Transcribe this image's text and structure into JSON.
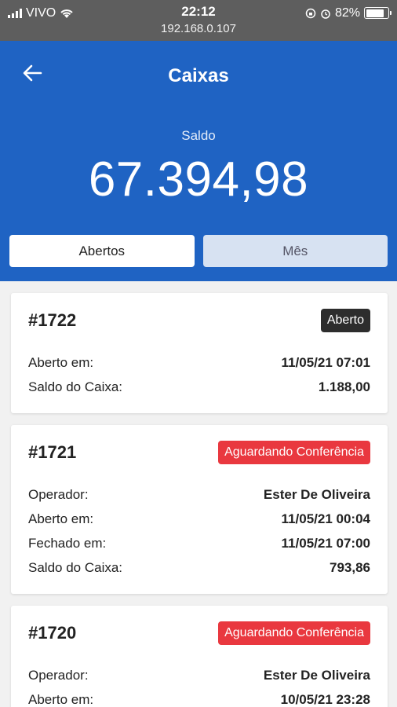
{
  "status": {
    "carrier": "VIVO",
    "time": "22:12",
    "battery": "82%",
    "url": "192.168.0.107",
    "battery_level": 0.82
  },
  "header": {
    "title": "Caixas",
    "saldo_label": "Saldo",
    "saldo_value": "67.394,98"
  },
  "tabs": [
    {
      "label": "Abertos",
      "active": true
    },
    {
      "label": "Mês",
      "active": false
    }
  ],
  "cards": [
    {
      "id": "#1722",
      "badge": "Aberto",
      "badge_color": "#2d2d2d",
      "rows": [
        {
          "k": "Aberto em:",
          "v": "11/05/21 07:01"
        },
        {
          "k": "Saldo do Caixa:",
          "v": "1.188,00"
        }
      ]
    },
    {
      "id": "#1721",
      "badge": "Aguardando Conferência",
      "badge_color": "#e9383f",
      "rows": [
        {
          "k": "Operador:",
          "v": "Ester De Oliveira"
        },
        {
          "k": "Aberto em:",
          "v": "11/05/21 00:04"
        },
        {
          "k": "Fechado em:",
          "v": "11/05/21 07:00"
        },
        {
          "k": "Saldo do Caixa:",
          "v": "793,86"
        }
      ]
    },
    {
      "id": "#1720",
      "badge": "Aguardando Conferência",
      "badge_color": "#e9383f",
      "rows": [
        {
          "k": "Operador:",
          "v": "Ester De Oliveira"
        },
        {
          "k": "Aberto em:",
          "v": "10/05/21 23:28"
        }
      ]
    }
  ]
}
